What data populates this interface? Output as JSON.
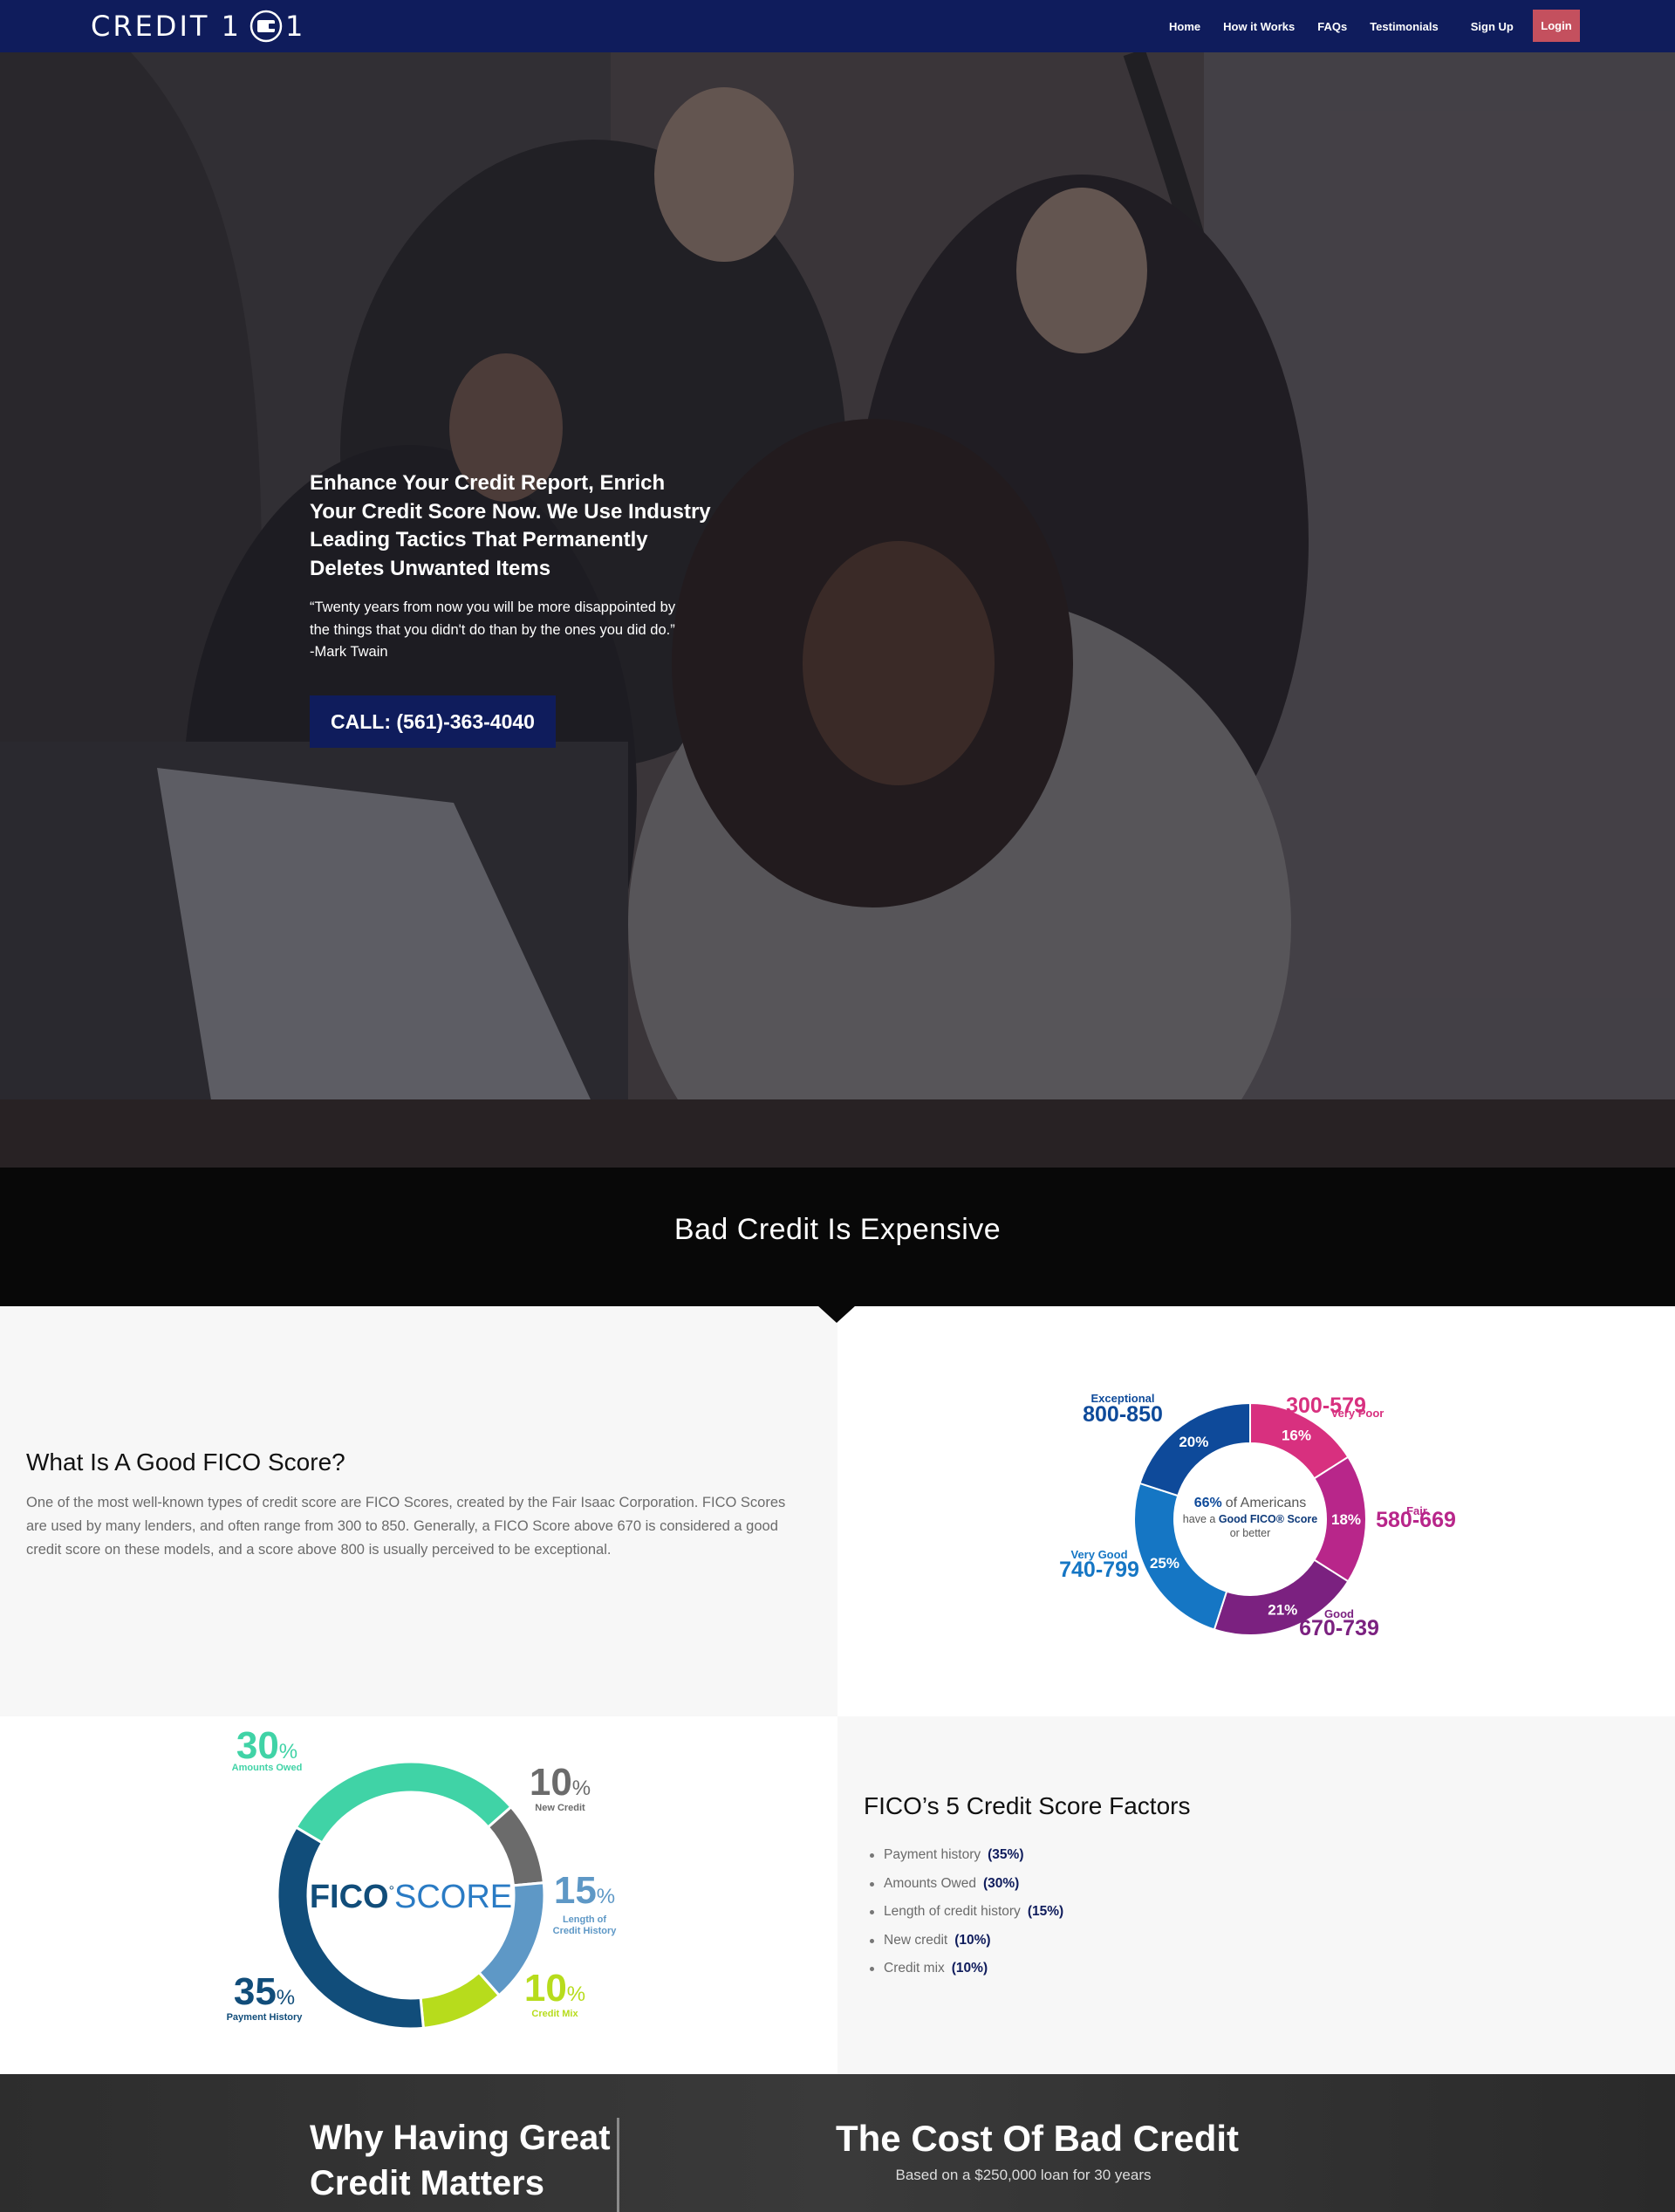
{
  "nav": {
    "logo": "CREDIT 101",
    "links": [
      "Home",
      "How it Works",
      "FAQs",
      "Testimonials",
      "Sign Up"
    ],
    "login": "Login"
  },
  "hero": {
    "heading_lines": [
      "Enhance Your Credit Report, Enrich",
      "Your Credit Score Now. We Use Industry",
      "Leading Tactics That Permanently",
      "Deletes Unwanted Items"
    ],
    "quote_lines": [
      "“Twenty years from now you will be more disappointed by",
      "the things that you didn't do than by the ones you did do.”",
      "-Mark Twain"
    ],
    "cta": "CALL: (561)-363-4040"
  },
  "band": {
    "title": "Bad Credit Is Expensive"
  },
  "fico_section": {
    "title": "What Is A Good FICO Score?",
    "text": "One of the most well-known types of credit score are FICO Scores, created by the Fair Isaac Corporation. FICO Scores are used by many lenders, and often range from 300 to 850. Generally, a FICO Score above 670 is considered a good credit score on these models, and a score above 800 is usually perceived to be exceptional."
  },
  "factors_section": {
    "title": "FICO’s 5 Credit Score Factors",
    "items": [
      {
        "label": "Payment history",
        "pct": "(35%)"
      },
      {
        "label": "Amounts Owed",
        "pct": "(30%)"
      },
      {
        "label": "Length of credit history",
        "pct": "(15%)"
      },
      {
        "label": "New credit",
        "pct": "(10%)"
      },
      {
        "label": "Credit mix",
        "pct": "(10%)"
      }
    ]
  },
  "bottom": {
    "why_lines": [
      "Why Having Great",
      "Credit Matters"
    ],
    "cost_title": "The Cost Of Bad Credit",
    "cost_sub": "Based on a $250,000 loan for 30 years"
  },
  "chart_data": [
    {
      "type": "pie",
      "title": "",
      "center_text": {
        "pct": "66%",
        "line1": "of Americans",
        "line2_prefix": "have a",
        "line2_bold": "Good FICO® Score",
        "line3": "or better"
      },
      "slices": [
        {
          "name": "Very Poor",
          "range": "300-579",
          "value": 16,
          "label": "16%",
          "color": "#d8307f"
        },
        {
          "name": "Fair",
          "range": "580-669",
          "value": 18,
          "label": "18%",
          "color": "#b8268a"
        },
        {
          "name": "Good",
          "range": "670-739",
          "value": 21,
          "label": "21%",
          "color": "#7b2180"
        },
        {
          "name": "Very Good",
          "range": "740-799",
          "value": 25,
          "label": "25%",
          "color": "#1576c4"
        },
        {
          "name": "Exceptional",
          "range": "800-850",
          "value": 20,
          "label": "20%",
          "color": "#0e4a9a"
        }
      ]
    },
    {
      "type": "pie",
      "title": "",
      "center_text": {
        "bold": "FICO",
        "reg": "°",
        "light": "SCORE"
      },
      "slices": [
        {
          "name": "Amounts Owed",
          "value": 30,
          "label": "30",
          "color": "#40d3a6"
        },
        {
          "name": "New Credit",
          "value": 10,
          "label": "10",
          "color": "#6b6b6b"
        },
        {
          "name": "Length of Credit History",
          "value": 15,
          "label": "15",
          "color": "#5e98c6"
        },
        {
          "name": "Credit Mix",
          "value": 10,
          "label": "10",
          "color": "#b7dc1c"
        },
        {
          "name": "Payment History",
          "value": 35,
          "label": "35",
          "color": "#114d7a"
        }
      ]
    }
  ],
  "colors": {
    "navy": "#0f1c5c",
    "login": "#c4505e",
    "band": "#080808"
  }
}
